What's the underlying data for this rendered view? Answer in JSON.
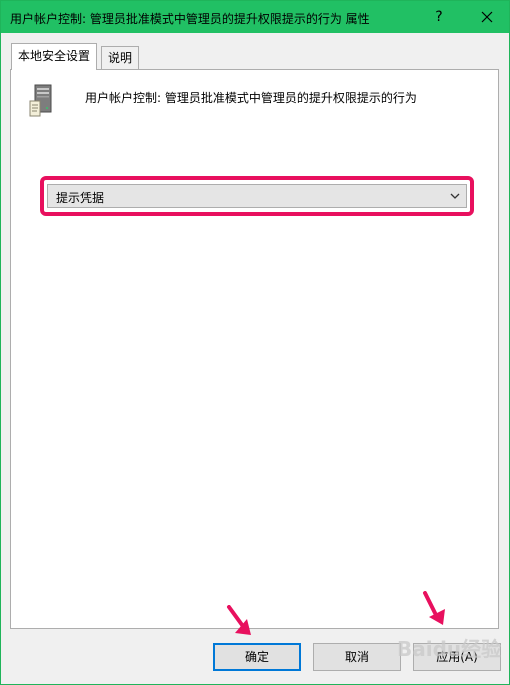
{
  "window": {
    "title": "用户帐户控制: 管理员批准模式中管理员的提升权限提示的行为 属性",
    "help_label": "?",
    "titlebar_color": "#21c064"
  },
  "tabs": [
    {
      "label": "本地安全设置",
      "active": true
    },
    {
      "label": "说明",
      "active": false
    }
  ],
  "policy": {
    "icon": "server-tower-icon",
    "title": "用户帐户控制: 管理员批准模式中管理员的提升权限提示的行为"
  },
  "dropdown": {
    "value": "提示凭据",
    "highlight_color": "#e8105e"
  },
  "buttons": {
    "ok": "确定",
    "cancel": "取消",
    "apply": "应用(A)"
  },
  "watermark": "Baidu经验",
  "annotation_arrow_color": "#e8105e"
}
